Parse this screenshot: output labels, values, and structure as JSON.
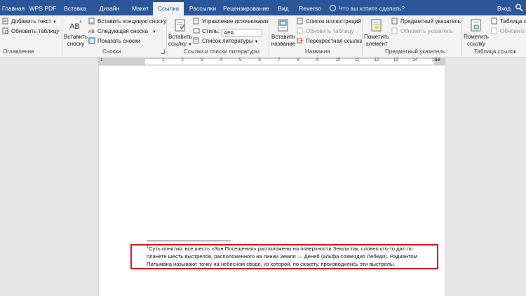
{
  "tabs": [
    "Главная",
    "WPS PDF",
    "Вставка",
    "Дизайн",
    "Макет",
    "Ссылки",
    "Рассылки",
    "Рецензирование",
    "Вид",
    "Reverso"
  ],
  "active_tab": "Ссылки",
  "tell_me": "Что вы хотите сделать?",
  "login": "Вход",
  "ribbon": {
    "toc": {
      "add_text": "Добавить текст",
      "update_table": "Обновить таблицу",
      "label": "Оглавление"
    },
    "footnotes": {
      "insert_footnote": [
        "Вставить",
        "сноску"
      ],
      "insert_endnote": "Вставить концевую сноску",
      "next_footnote": "Следующая сноска",
      "show_notes": "Показать сноски",
      "label": "Сноски"
    },
    "citations": {
      "insert_citation": [
        "Вставить",
        "ссылку"
      ],
      "manage_sources": "Управление источниками",
      "style_label": "Стиль:",
      "style_value": "APA",
      "bibliography": "Список литературы",
      "label": "Ссылки и списки литературы"
    },
    "captions": {
      "insert_caption": [
        "Вставить",
        "название"
      ],
      "table_of_figures": "Список иллюстраций",
      "update_table": "Обновить таблицу",
      "cross_reference": "Перекрестная ссылка",
      "label": "Названия"
    },
    "index": {
      "mark_entry": [
        "Пометить",
        "элемент"
      ],
      "insert_index": "Предметный указатель",
      "update_index": "Обновить указатель",
      "label": "Предметный указатель"
    },
    "authorities": {
      "mark_citation": [
        "Пометить",
        "ссылку"
      ],
      "table_label_partial": "Таблица сс",
      "update_partial": "Обновить",
      "label": "Таблица ссылок"
    }
  },
  "ruler": {
    "numbers": [
      "1",
      "1",
      "2",
      "3",
      "4",
      "5",
      "6",
      "7",
      "8",
      "9",
      "10",
      "11",
      "12",
      "13",
      "14",
      "15",
      "16",
      "17"
    ]
  },
  "document": {
    "footnote_number": "1",
    "footnote_text": "Суть понятия: все шесть «Зон Посещения» расположены на поверхности Земли так, словно кто-то дал по планете шесть выстрелов, расположенного на линии Земля — Денеб (альфа созвездия Лебедя). Радиантом Пильмана называют точку на небесном своде, из которой, по сюжету, производились эти выстрелы."
  },
  "colors": {
    "ribbon_blue": "#2b579a",
    "highlight_red": "#e0121b"
  }
}
